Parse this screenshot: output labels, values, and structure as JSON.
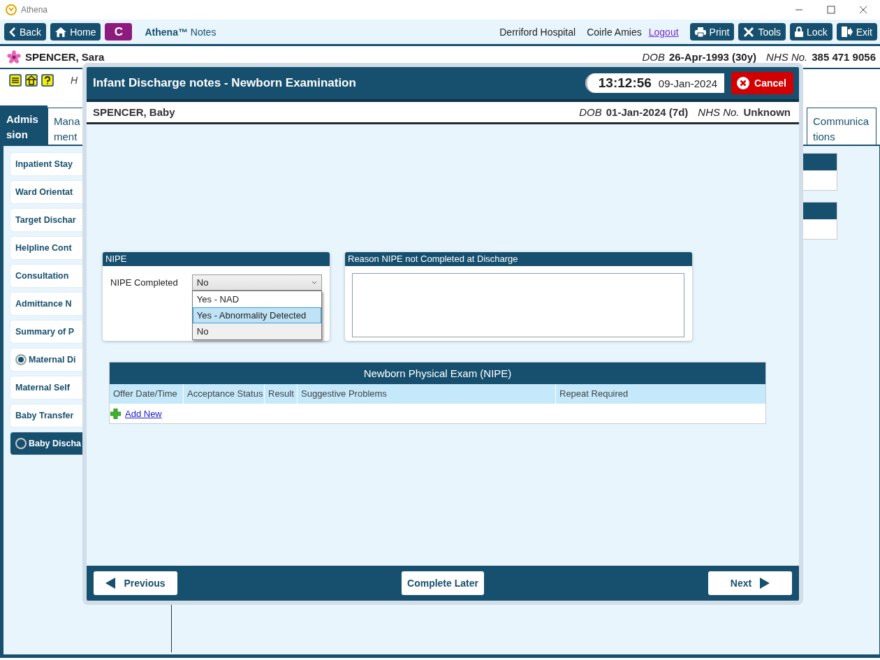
{
  "window": {
    "title": "Athena"
  },
  "toolbar": {
    "left_buttons": [
      {
        "kind": "back",
        "label": "Back"
      },
      {
        "kind": "home",
        "label": "Home"
      },
      {
        "kind": "letter",
        "label": "C"
      }
    ],
    "app_name": "**Athena™** Notes",
    "hospital": "Derriford Hospital",
    "user": "Coirle Amies",
    "logout": "Logout",
    "right_buttons": [
      {
        "kind": "print",
        "label": "Print"
      },
      {
        "kind": "tools",
        "label": "Tools"
      },
      {
        "kind": "lock",
        "label": "Lock"
      },
      {
        "kind": "exit",
        "label": "Exit"
      }
    ]
  },
  "patient": {
    "name": "SPENCER, Sara",
    "dob_label": "DOB",
    "dob": "26-Apr-1993 (30y)",
    "nhs_label": "NHS No.",
    "nhs": "385 471 9056"
  },
  "alerts": {
    "note": "H"
  },
  "tabs": [
    {
      "label": "Admission",
      "selected": true
    },
    {
      "label": "Mana ment",
      "selected": false
    },
    {
      "label": "Communications",
      "selected": false
    }
  ],
  "sidebar": {
    "items": [
      {
        "kind": "plain",
        "label": "Inpatient Stay",
        "selected": false
      },
      {
        "kind": "plain",
        "label": "Ward Orientat",
        "selected": false
      },
      {
        "kind": "plain",
        "label": "Target Dischar",
        "selected": false
      },
      {
        "kind": "plain",
        "label": "Helpline Cont",
        "selected": false
      },
      {
        "kind": "plain",
        "label": "Consultation",
        "selected": false
      },
      {
        "kind": "plain",
        "label": "Admittance N",
        "selected": false
      },
      {
        "kind": "plain",
        "label": "Summary of P",
        "selected": false
      },
      {
        "kind": "radio",
        "label": "Maternal Di",
        "selected": false,
        "checked": true
      },
      {
        "kind": "plain",
        "label": "Maternal Self",
        "selected": false
      },
      {
        "kind": "plain",
        "label": "Baby Transfer",
        "selected": false
      },
      {
        "kind": "radio",
        "label": "Baby Discha",
        "selected": true,
        "checked": false
      }
    ]
  },
  "dialog": {
    "title": "Infant Discharge notes - Newborn Examination",
    "time": "13:12:56",
    "date": "09-Jan-2024",
    "cancel": "Cancel",
    "patient": {
      "name": "SPENCER, Baby",
      "dob_label": "DOB",
      "dob": "01-Jan-2024 (7d)",
      "nhs_label": "NHS No.",
      "nhs": "Unknown"
    },
    "nipe": {
      "title": "NIPE",
      "field_label": "NIPE Completed",
      "value": "No",
      "options": [
        {
          "label": "Yes - NAD",
          "selected": false,
          "highlighted": false
        },
        {
          "label": "Yes - Abnormality Detected",
          "selected": false,
          "highlighted": true
        },
        {
          "label": "No",
          "selected": true,
          "highlighted": false
        }
      ]
    },
    "reason": {
      "title": "Reason NIPE not Completed at Discharge"
    },
    "table": {
      "title": "Newborn Physical Exam (NIPE)",
      "columns": [
        "Offer Date/Time",
        "Acceptance Status",
        "Result",
        "Suggestive Problems",
        "Repeat Required"
      ],
      "add_new": "Add New"
    },
    "footer": {
      "previous": "Previous",
      "complete_later": "Complete Later",
      "next": "Next"
    }
  }
}
